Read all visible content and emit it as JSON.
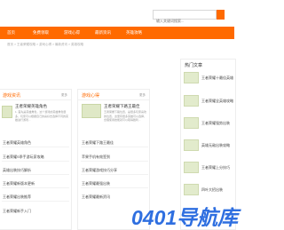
{
  "search": {
    "placeholder": "输入关键词搜索..."
  },
  "nav": {
    "items": [
      "首页",
      "免费领取",
      "游戏心得",
      "最新资讯",
      "英雄攻略"
    ]
  },
  "breadcrumb": "首页 > 王者荣耀攻略 > 游戏心得 > 最新资讯 > 英雄攻略",
  "left_card": {
    "title": "游戏资讯",
    "more": "更多",
    "feature_title": "王者荣耀英雄角色",
    "feature_desc": "1. 首先是英雄角色，这个游戏的英雄角色很多，玩家可以根据自己的喜好去选择不同的英雄进行游戏...",
    "items": [
      "王者荣耀英雄角色",
      "王者荣耀S季手游玩家攻略",
      "英雄出装技巧解析",
      "王者荣耀新版本更新",
      "王者荣耀出装推荐",
      "王者荣耀新手入门"
    ]
  },
  "middle_card": {
    "title": "游戏心得",
    "more": "更多",
    "feature_title": "王者荣耀下路王最佳",
    "feature_desc": "王者荣耀下路位置，是很多玩家喜欢的位置，这里有很多英雄可以选择，合理使用技能就可以取得胜利...",
    "items": [
      "王者荣耀下路王最佳",
      "苹果手机有效签到",
      "王者荣耀游戏技巧分享",
      "王者荣耀最强出装",
      "王者荣耀最新资讯"
    ]
  },
  "right_card": {
    "title": "热门文章",
    "items": [
      "王者荣耀十最佳英雄",
      "王者荣耀全英雄攻略",
      "王者荣耀强势出装",
      "英雄无敌出装攻略",
      "王者荣耀上分技巧",
      "四叶大招出装"
    ]
  },
  "watermark": {
    "text": "0401导航库",
    "logo": "库"
  }
}
